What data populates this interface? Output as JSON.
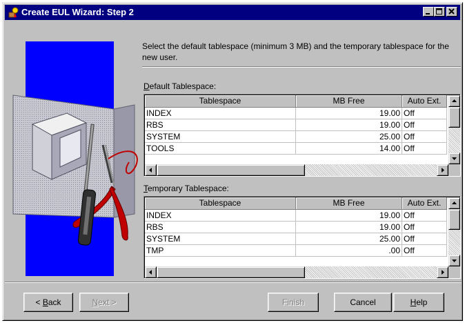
{
  "window": {
    "title": "Create EUL Wizard: Step 2",
    "icon": "wizard-app-icon",
    "controls": [
      "minimize-icon",
      "maximize-icon",
      "close-icon"
    ]
  },
  "wizard_image": {
    "icon": "toolbox-illustration"
  },
  "intro_text": "Select the default tablespace (minimum 3 MB) and the temporary tablespace for the new user.",
  "default_section": {
    "label_prefix": "D",
    "label_rest": "efault Tablespace:",
    "columns": [
      "Tablespace",
      "MB Free",
      "Auto Ext."
    ],
    "rows": [
      {
        "name": "INDEX",
        "mb_free": "19.00",
        "auto_ext": "Off"
      },
      {
        "name": "RBS",
        "mb_free": "19.00",
        "auto_ext": "Off"
      },
      {
        "name": "SYSTEM",
        "mb_free": "25.00",
        "auto_ext": "Off"
      },
      {
        "name": "TOOLS",
        "mb_free": "14.00",
        "auto_ext": "Off"
      }
    ]
  },
  "temporary_section": {
    "label_prefix": "T",
    "label_rest": "emporary Tablespace:",
    "columns": [
      "Tablespace",
      "MB Free",
      "Auto Ext."
    ],
    "rows": [
      {
        "name": "INDEX",
        "mb_free": "19.00",
        "auto_ext": "Off"
      },
      {
        "name": "RBS",
        "mb_free": "19.00",
        "auto_ext": "Off"
      },
      {
        "name": "SYSTEM",
        "mb_free": "25.00",
        "auto_ext": "Off"
      },
      {
        "name": "TMP",
        "mb_free": ".00",
        "auto_ext": "Off"
      }
    ]
  },
  "buttons": {
    "back_prefix": "< ",
    "back_mnemonic": "B",
    "back_rest": "ack",
    "next_prefix": "N",
    "next_rest": "ext >",
    "finish": "Finish",
    "cancel": "Cancel",
    "help_mnemonic": "H",
    "help_rest": "elp"
  }
}
